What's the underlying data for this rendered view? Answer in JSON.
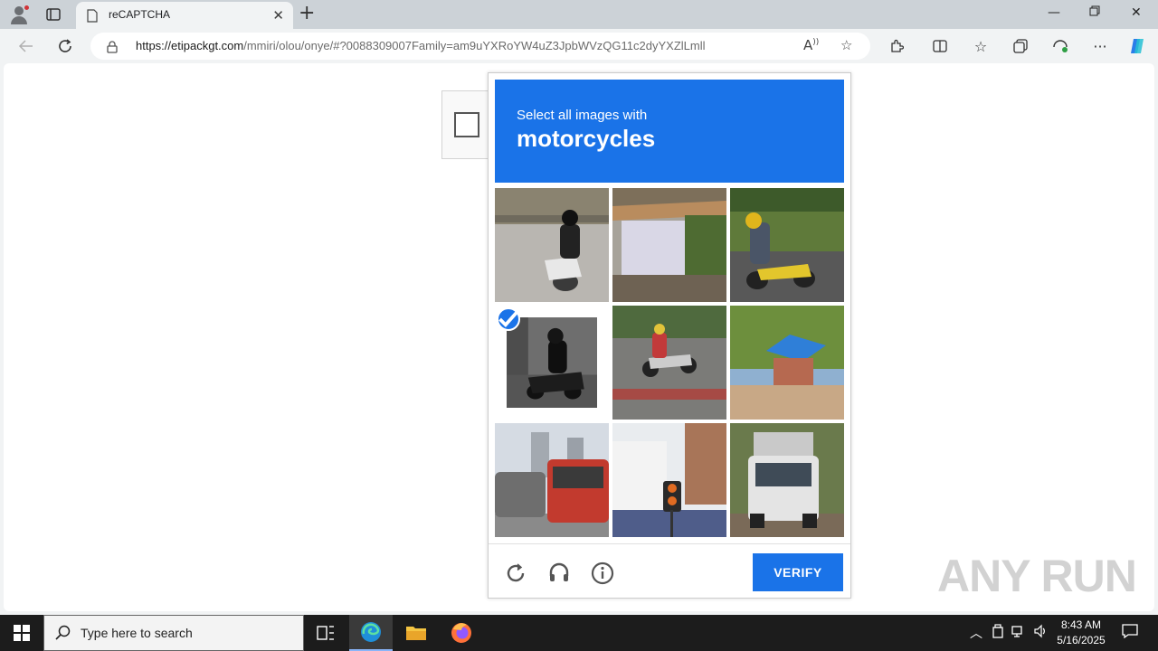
{
  "browser": {
    "tab_title": "reCAPTCHA",
    "url_domain": "https://etipackgt.com",
    "url_path": "/mmiri/olou/onye/#?0088309007Family=am9uYXRoYW4uZ3JpbWVzQG11c2dyYXZlLmll"
  },
  "captcha": {
    "instruction_line1": "Select all images with",
    "instruction_line2": "motorcycles",
    "verify_label": "VERIFY",
    "tiles": [
      {
        "subject": "motorcycle",
        "selected": false
      },
      {
        "subject": "shelter",
        "selected": false
      },
      {
        "subject": "motorcycle",
        "selected": false
      },
      {
        "subject": "motorcycle",
        "selected": true
      },
      {
        "subject": "motorcycle",
        "selected": false
      },
      {
        "subject": "house",
        "selected": false
      },
      {
        "subject": "bus",
        "selected": false
      },
      {
        "subject": "traffic-light",
        "selected": false
      },
      {
        "subject": "truck",
        "selected": false
      }
    ],
    "accent_color": "#1a73e8"
  },
  "watermark": "ANY RUN",
  "taskbar": {
    "search_placeholder": "Type here to search",
    "time": "8:43 AM",
    "date": "5/16/2025"
  }
}
